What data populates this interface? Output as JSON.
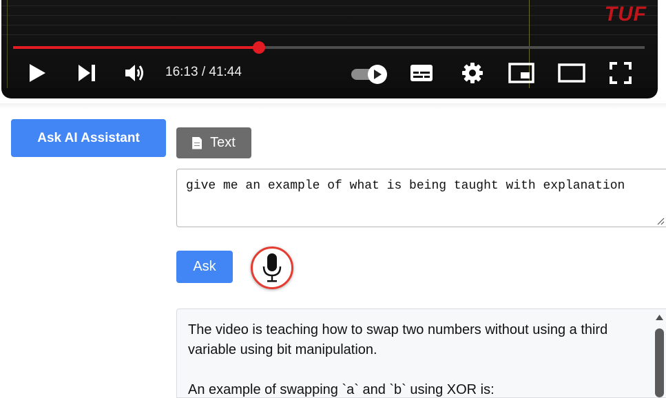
{
  "player": {
    "watermark": "TUF",
    "time_display": "16:13 / 41:44",
    "progress_fraction": 0.389,
    "accent_color": "#e31b23",
    "controls": {
      "play": "play-icon",
      "next": "skip-next-icon",
      "volume": "volume-icon",
      "autoplay": "autoplay-toggle",
      "captions": "subtitles-icon",
      "settings": "gear-icon",
      "miniplayer": "miniplayer-icon",
      "theater": "theater-mode-icon",
      "fullscreen": "fullscreen-icon"
    }
  },
  "assistant": {
    "ask_ai_label": "Ask AI Assistant",
    "mode_label": "Text",
    "question_value": "give me an example of what is being taught with explanation",
    "ask_label": "Ask",
    "mic_icon": "microphone-icon",
    "answer_line1": "The video is teaching how to swap two numbers without using a third variable using bit manipulation.",
    "answer_line2": "An example of swapping `a` and `b` using XOR is:",
    "accent_color": "#4285f4"
  }
}
